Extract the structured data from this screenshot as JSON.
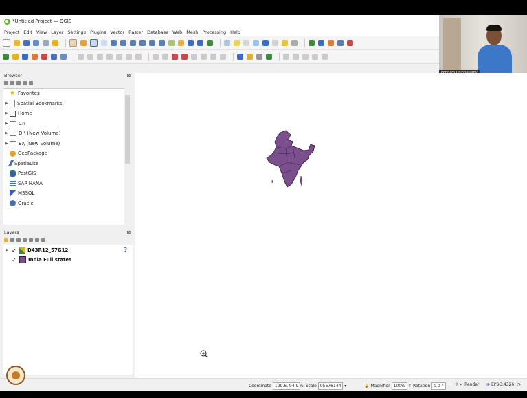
{
  "window": {
    "title": "*Untitled Project — QGIS"
  },
  "menubar": [
    "Project",
    "Edit",
    "View",
    "Layer",
    "Settings",
    "Plugins",
    "Vector",
    "Raster",
    "Database",
    "Web",
    "Mesh",
    "Processing",
    "Help"
  ],
  "webcam": {
    "name": "Ponnam Chinnasamy"
  },
  "browser": {
    "title": "Browser",
    "items": [
      {
        "label": "Favorites",
        "icon": "star-icon"
      },
      {
        "label": "Spatial Bookmarks",
        "icon": "bookmark-icon"
      },
      {
        "label": "Home",
        "icon": "home-icon"
      },
      {
        "label": "C:\\",
        "icon": "folder-icon"
      },
      {
        "label": "D:\\ (New Volume)",
        "icon": "folder-icon"
      },
      {
        "label": "E:\\ (New Volume)",
        "icon": "folder-icon"
      },
      {
        "label": "GeoPackage",
        "icon": "geopackage-icon"
      },
      {
        "label": "SpatiaLite",
        "icon": "feather-icon"
      },
      {
        "label": "PostGIS",
        "icon": "elephant-icon"
      },
      {
        "label": "SAP HANA",
        "icon": "database-icon"
      },
      {
        "label": "MSSQL",
        "icon": "mssql-icon"
      },
      {
        "label": "Oracle",
        "icon": "oracle-icon"
      }
    ]
  },
  "layers": {
    "title": "Layers",
    "items": [
      {
        "label": "D43R12_57G12",
        "checked": true,
        "type": "raster"
      },
      {
        "label": "India Full states",
        "checked": true,
        "type": "polygon",
        "color": "#7b4f8e"
      }
    ]
  },
  "statusbar": {
    "coordinate_label": "Coordinate",
    "coordinate_value": "129.6, 94.9",
    "scale_label": "Scale",
    "scale_value": "95676144",
    "magnifier_label": "Magnifier",
    "magnifier_value": "100%",
    "rotation_label": "Rotation",
    "rotation_value": "0.0 °",
    "render_label": "Render",
    "crs_label": "EPSG:4326"
  },
  "colors": {
    "india_fill": "#7b4f8e",
    "india_stroke": "#2e1f36"
  }
}
